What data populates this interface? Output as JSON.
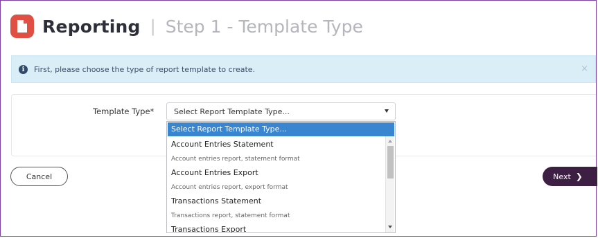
{
  "header": {
    "title": "Reporting",
    "separator": "|",
    "step": "Step 1 - Template Type"
  },
  "alert": {
    "message": "First, please choose the type of report template to create.",
    "close": "×"
  },
  "form": {
    "template_type_label": "Template Type*",
    "select_value": "Select Report Template Type...",
    "options": [
      {
        "label": "Select Report Template Type...",
        "kind": "main",
        "selected": true
      },
      {
        "label": "Account Entries Statement",
        "kind": "main"
      },
      {
        "label": "Account entries report, statement format",
        "kind": "sub"
      },
      {
        "label": "Account Entries Export",
        "kind": "main"
      },
      {
        "label": "Account entries report, export format",
        "kind": "sub"
      },
      {
        "label": "Transactions Statement",
        "kind": "main"
      },
      {
        "label": "Transactions report, statement format",
        "kind": "sub"
      },
      {
        "label": "Transactions Export",
        "kind": "main"
      }
    ]
  },
  "buttons": {
    "cancel": "Cancel",
    "next": "Next",
    "next_icon": "❯"
  },
  "colors": {
    "brand": "#e04f43",
    "next_button": "#3d1f44",
    "selected_option": "#3a85d0",
    "alert_bg": "#d9eef7"
  },
  "icons": {
    "logo": "document-icon",
    "alert": "info-icon",
    "close": "close-icon",
    "caret": "caret-down-icon",
    "next": "chevron-right-icon"
  }
}
